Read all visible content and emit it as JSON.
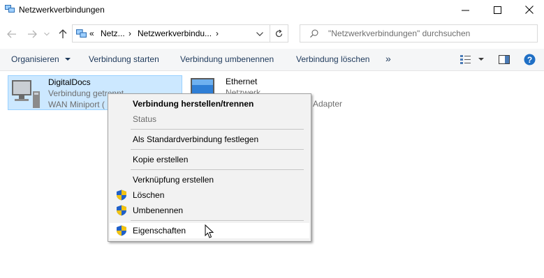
{
  "window": {
    "title": "Netzwerkverbindungen",
    "controls": {
      "minimize": "—",
      "maximize": "☐",
      "close": "✕"
    }
  },
  "address": {
    "prefix": "«",
    "crumbs": [
      "Netz...",
      "Netzwerkverbindu..."
    ],
    "separator": "›",
    "search_placeholder": "\"Netzwerkverbindungen\" durchsuchen"
  },
  "toolbar": {
    "organize": "Organisieren",
    "start": "Verbindung starten",
    "rename": "Verbindung umbenennen",
    "delete": "Verbindung löschen",
    "more": "»"
  },
  "items": [
    {
      "name": "DigitalDocs",
      "status": "Verbindung getrennt",
      "device": "WAN Miniport ("
    },
    {
      "name": "Ethernet",
      "status": "Netzwerk",
      "device": "Adapter"
    }
  ],
  "context_menu": {
    "items": [
      {
        "label": "Verbindung herstellen/trennen",
        "bold": true
      },
      {
        "label": "Status",
        "disabled": true
      },
      {
        "label": "Als Standardverbindung festlegen"
      },
      {
        "label": "Kopie erstellen"
      },
      {
        "label": "Verknüpfung erstellen"
      },
      {
        "label": "Löschen",
        "shield": true
      },
      {
        "label": "Umbenennen",
        "shield": true
      },
      {
        "label": "Eigenschaften",
        "shield": true,
        "hovered": true
      }
    ]
  },
  "colors": {
    "accent": "#0078d7",
    "selection": "#cce8ff",
    "command_text": "#1e395b",
    "disabled_text": "#6d6d6d"
  }
}
